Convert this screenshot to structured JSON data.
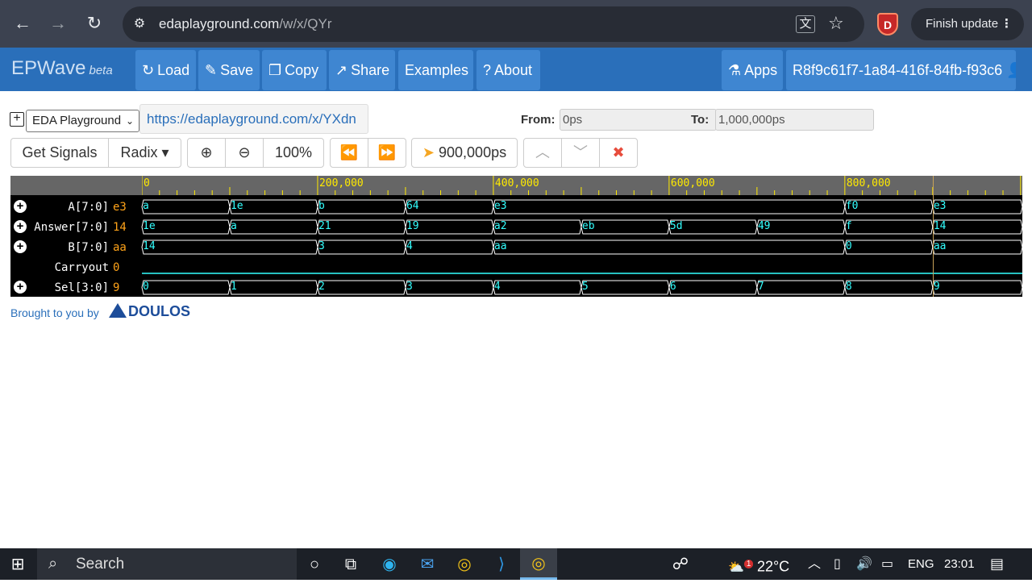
{
  "browser": {
    "url_host": "edaplayground.com",
    "url_path": "/w/x/QYr",
    "finish_update_label": "Finish update",
    "extension_letter": "D"
  },
  "toolbar": {
    "brand": "EPWave",
    "brand_tag": "beta",
    "load": "Load",
    "save": "Save",
    "copy": "Copy",
    "share": "Share",
    "examples": "Examples",
    "about": "About",
    "apps": "Apps",
    "user_id": "R8f9c61f7-1a84-416f-84fb-f93c6"
  },
  "controls": {
    "plus": "+",
    "source_select": "EDA Playground",
    "link": "https://edaplayground.com/x/YXdn",
    "from_label": "From:",
    "from_value": "0ps",
    "to_label": "To:",
    "to_value": "1,000,000ps",
    "get_signals": "Get Signals",
    "radix": "Radix",
    "zoom_level": "100%",
    "cursor_time": "900,000ps"
  },
  "ruler": {
    "labels": [
      "0",
      "200,000",
      "400,000",
      "600,000",
      "800,000"
    ]
  },
  "signals": [
    {
      "name": "A[7:0]",
      "value": "e3",
      "expandable": true,
      "segments": [
        [
          "0",
          "a"
        ],
        [
          "100000",
          "1e"
        ],
        [
          "200000",
          "b"
        ],
        [
          "300000",
          "64"
        ],
        [
          "400000",
          "e3"
        ],
        [
          "800000",
          "f0"
        ],
        [
          "900000",
          "e3"
        ]
      ]
    },
    {
      "name": "Answer[7:0]",
      "value": "14",
      "expandable": true,
      "segments": [
        [
          "0",
          "1e"
        ],
        [
          "100000",
          "a"
        ],
        [
          "200000",
          "21"
        ],
        [
          "300000",
          "19"
        ],
        [
          "400000",
          "a2"
        ],
        [
          "500000",
          "eb"
        ],
        [
          "600000",
          "5d"
        ],
        [
          "700000",
          "49"
        ],
        [
          "800000",
          "f"
        ],
        [
          "900000",
          "14"
        ]
      ]
    },
    {
      "name": "B[7:0]",
      "value": "aa",
      "expandable": true,
      "segments": [
        [
          "0",
          "14"
        ],
        [
          "200000",
          "3"
        ],
        [
          "300000",
          "4"
        ],
        [
          "400000",
          "aa"
        ],
        [
          "800000",
          "0"
        ],
        [
          "900000",
          "aa"
        ]
      ]
    },
    {
      "name": "Carryout",
      "value": "0",
      "expandable": false,
      "segments": []
    },
    {
      "name": "Sel[3:0]",
      "value": "9",
      "expandable": true,
      "segments": [
        [
          "0",
          "0"
        ],
        [
          "100000",
          "1"
        ],
        [
          "200000",
          "2"
        ],
        [
          "300000",
          "3"
        ],
        [
          "400000",
          "4"
        ],
        [
          "500000",
          "5"
        ],
        [
          "600000",
          "6"
        ],
        [
          "700000",
          "7"
        ],
        [
          "800000",
          "8"
        ],
        [
          "900000",
          "9"
        ]
      ]
    }
  ],
  "footer": {
    "brought_by": "Brought to you by",
    "company": "DOULOS"
  },
  "taskbar": {
    "search_label": "Search",
    "temperature": "22°C",
    "language": "ENG",
    "time": "23:01",
    "weather_badge": "1"
  },
  "colors": {
    "app_blue": "#2a6fba",
    "wave_value": "#33ffff",
    "ruler_text": "#ffea00",
    "signal_value": "#ffa319"
  }
}
